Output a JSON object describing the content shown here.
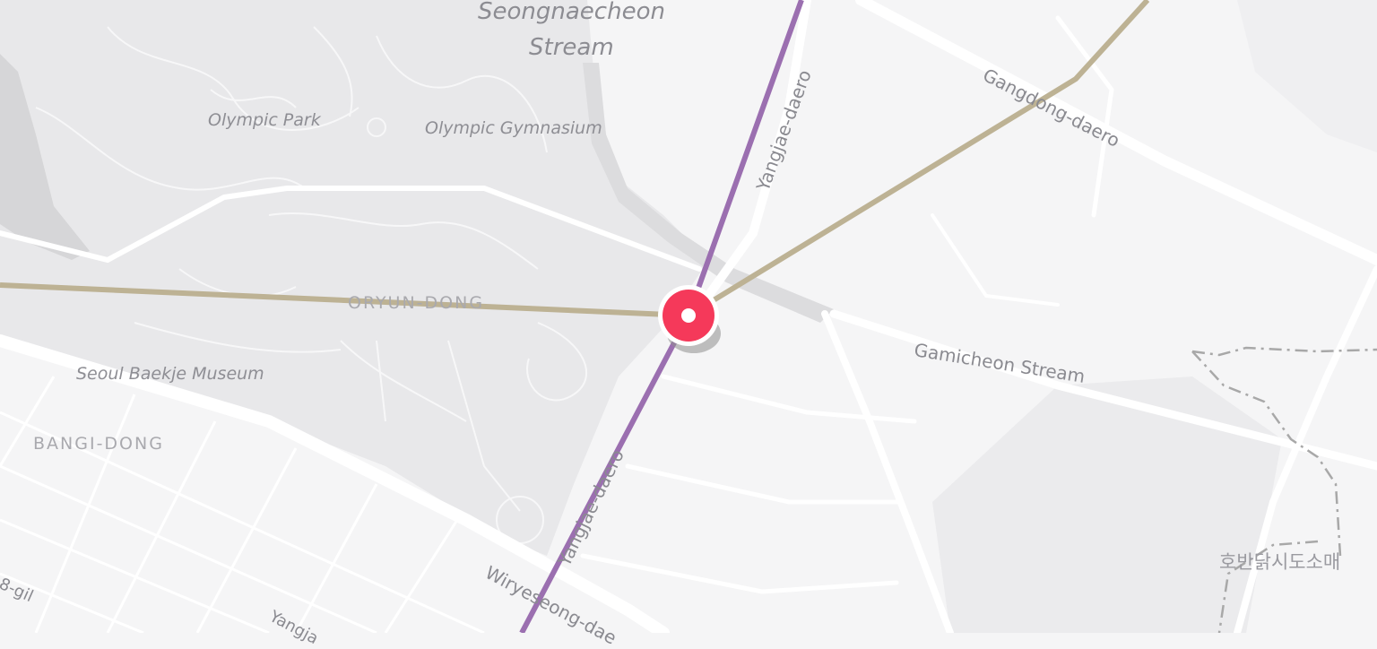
{
  "map": {
    "water_labels": {
      "stream_north_line1": "Seongnaecheon",
      "stream_north_line2": "Stream",
      "gamicheon": "Gamicheon Stream"
    },
    "poi_labels": {
      "olympic_park": "Olympic Park",
      "olympic_gymnasium": "Olympic Gymnasium",
      "baekje_museum": "Seoul Baekje Museum"
    },
    "district_labels": {
      "oryun": "ORYUN-DONG",
      "bangi": "BANGI-DONG"
    },
    "road_labels": {
      "yangjae_north": "Yangjae-daero",
      "yangjae_south": "Yangjae-daero",
      "yangjae_sw_partial": "Yangja",
      "gangdong": "Gangdong-daero",
      "wiryeseong": "Wiryeseong-dae",
      "gil_partial": "8-gil",
      "korean_market": "호반닭시도소매"
    },
    "colors": {
      "background": "#f5f5f6",
      "park_area": "#e8e8ea",
      "water": "#d6d6d8",
      "road": "#ffffff",
      "route_purple": "#9b6fb0",
      "route_tan": "#bdb294",
      "marker": "#f5395a",
      "boundary_dash": "#a8a8a8"
    },
    "marker_icon": "location-pin-icon"
  }
}
